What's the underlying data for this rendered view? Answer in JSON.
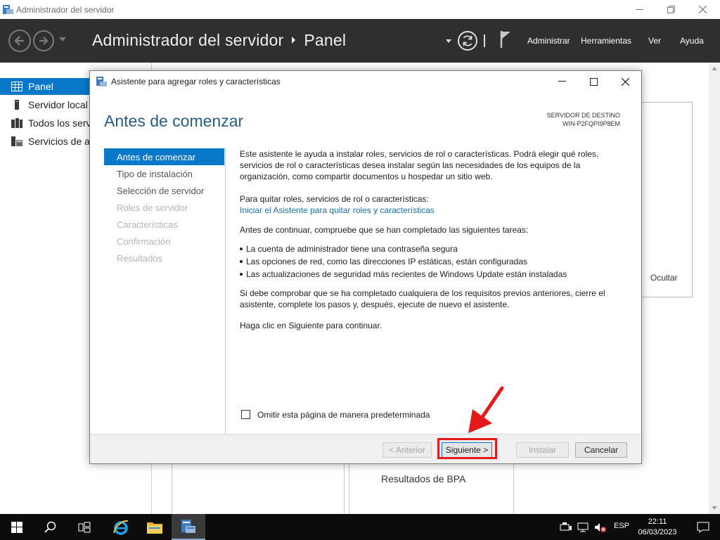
{
  "window": {
    "title": "Administrador del servidor"
  },
  "header": {
    "app_name": "Administrador del servidor",
    "page": "Panel",
    "menu": {
      "administrar": "Administrar",
      "herramientas": "Herramientas",
      "ver": "Ver",
      "ayuda": "Ayuda"
    }
  },
  "sidebar": {
    "items": [
      {
        "label": "Panel",
        "icon": "dashboard-icon",
        "active": true
      },
      {
        "label": "Servidor local",
        "icon": "server-icon",
        "active": false
      },
      {
        "label": "Todos los serv",
        "icon": "servers-icon",
        "active": false
      },
      {
        "label": "Servicios de ar",
        "icon": "file-services-icon",
        "active": false
      }
    ]
  },
  "background": {
    "hide_label": "Ocultar",
    "bpa_label": "Resultados de BPA"
  },
  "dialog": {
    "title": "Asistente para agregar roles y características",
    "heading": "Antes de comenzar",
    "destination_label": "SERVIDOR DE DESTINO",
    "destination_server": "WIN-P2FQPI9P8EM",
    "steps": [
      {
        "label": "Antes de comenzar",
        "state": "active"
      },
      {
        "label": "Tipo de instalación",
        "state": "enabled"
      },
      {
        "label": "Selección de servidor",
        "state": "enabled"
      },
      {
        "label": "Roles de servidor",
        "state": "disabled"
      },
      {
        "label": "Características",
        "state": "disabled"
      },
      {
        "label": "Confirmación",
        "state": "disabled"
      },
      {
        "label": "Resultados",
        "state": "disabled"
      }
    ],
    "intro": "Este asistente le ayuda a instalar roles, servicios de rol o características. Podrá elegir qué roles, servicios de rol o características desea instalar según las necesidades de los equipos de la organización, como compartir documentos u hospedar un sitio web.",
    "remove_label": "Para quitar roles, servicios de rol o características:",
    "remove_link": "Iniciar el Asistente para quitar roles y características",
    "check_intro": "Antes de continuar, compruebe que se han completado las siguientes tareas:",
    "bullets": [
      "La cuenta de administrador tiene una contraseña segura",
      "Las opciones de red, como las direcciones IP estáticas, están configuradas",
      "Las actualizaciones de seguridad más recientes de Windows Update están instaladas"
    ],
    "prereq_note": "Si debe comprobar que se ha completado cualquiera de los requisitos previos anteriores, cierre el asistente, complete los pasos y, después, ejecute de nuevo el asistente.",
    "continue_note": "Haga clic en Siguiente para continuar.",
    "skip_checkbox": "Omitir esta página de manera predeterminada",
    "skip_checked": false,
    "buttons": {
      "previous": "< Anterior",
      "next": "Siguiente >",
      "install": "Instalar",
      "cancel": "Cancelar"
    }
  },
  "taskbar": {
    "language": "ESP",
    "time": "22:11",
    "date": "06/03/2023"
  },
  "colors": {
    "accent": "#0a78c8",
    "header_bg": "#2f2f2f",
    "heading": "#2b5c82",
    "link": "#1a6fb0",
    "highlight": "#e41a1a"
  }
}
